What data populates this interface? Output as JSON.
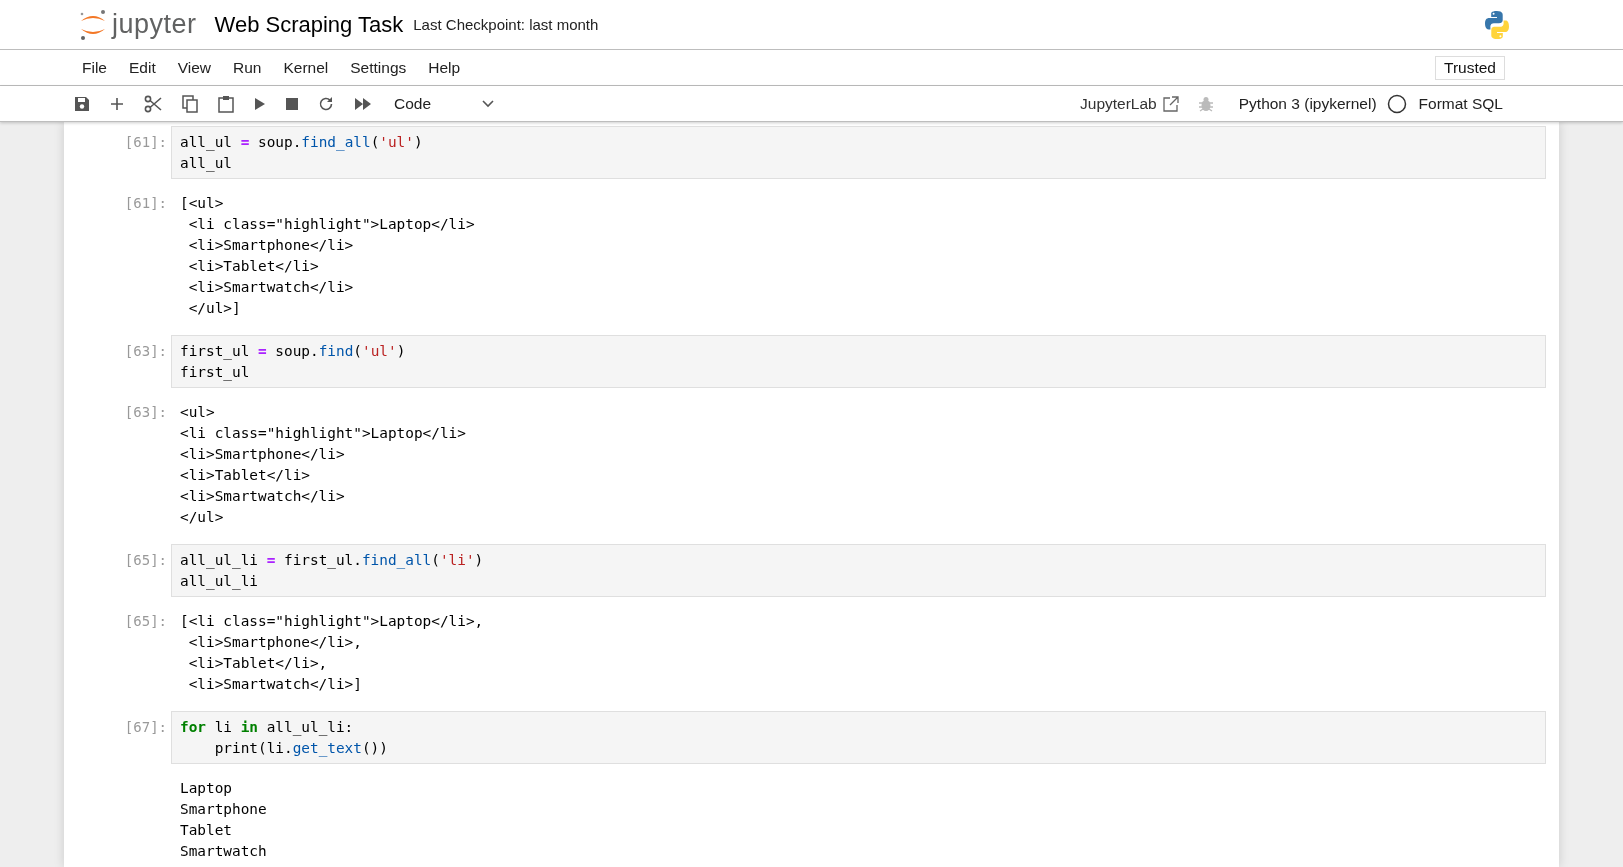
{
  "header": {
    "logo_text": "jupyter",
    "title": "Web Scraping Task",
    "checkpoint": "Last Checkpoint: last month"
  },
  "menu": [
    "File",
    "Edit",
    "View",
    "Run",
    "Kernel",
    "Settings",
    "Help"
  ],
  "trusted": "Trusted",
  "toolbar": {
    "cell_type": "Code",
    "jupyterlab": "JupyterLab",
    "kernel": "Python 3 (ipykernel)",
    "kernel_busy": false,
    "format": "Format SQL"
  },
  "cells": [
    {
      "kind": "code",
      "prompt": "[61]:",
      "lines": [
        [
          {
            "kind": "plain",
            "text": "all_ul "
          },
          {
            "kind": "op",
            "text": "="
          },
          {
            "kind": "plain",
            "text": " soup."
          },
          {
            "kind": "func",
            "text": "find_all"
          },
          {
            "kind": "plain",
            "text": "("
          },
          {
            "kind": "string",
            "text": "'ul'"
          },
          {
            "kind": "plain",
            "text": ")"
          }
        ],
        [
          {
            "kind": "plain",
            "text": "all_ul"
          }
        ]
      ]
    },
    {
      "kind": "output",
      "prompt": "[61]:",
      "lines": [
        "[<ul>",
        " <li class=\"highlight\">Laptop</li>",
        " <li>Smartphone</li>",
        " <li>Tablet</li>",
        " <li>Smartwatch</li>",
        " </ul>]"
      ]
    },
    {
      "kind": "code",
      "prompt": "[63]:",
      "lines": [
        [
          {
            "kind": "plain",
            "text": "first_ul "
          },
          {
            "kind": "op",
            "text": "="
          },
          {
            "kind": "plain",
            "text": " soup."
          },
          {
            "kind": "func",
            "text": "find"
          },
          {
            "kind": "plain",
            "text": "("
          },
          {
            "kind": "string",
            "text": "'ul'"
          },
          {
            "kind": "plain",
            "text": ")"
          }
        ],
        [
          {
            "kind": "plain",
            "text": "first_ul"
          }
        ]
      ]
    },
    {
      "kind": "output",
      "prompt": "[63]:",
      "lines": [
        "<ul>",
        "<li class=\"highlight\">Laptop</li>",
        "<li>Smartphone</li>",
        "<li>Tablet</li>",
        "<li>Smartwatch</li>",
        "</ul>"
      ]
    },
    {
      "kind": "code",
      "prompt": "[65]:",
      "lines": [
        [
          {
            "kind": "plain",
            "text": "all_ul_li "
          },
          {
            "kind": "op",
            "text": "="
          },
          {
            "kind": "plain",
            "text": " first_ul."
          },
          {
            "kind": "func",
            "text": "find_all"
          },
          {
            "kind": "plain",
            "text": "("
          },
          {
            "kind": "string",
            "text": "'li'"
          },
          {
            "kind": "plain",
            "text": ")"
          }
        ],
        [
          {
            "kind": "plain",
            "text": "all_ul_li"
          }
        ]
      ]
    },
    {
      "kind": "output",
      "prompt": "[65]:",
      "lines": [
        "[<li class=\"highlight\">Laptop</li>,",
        " <li>Smartphone</li>,",
        " <li>Tablet</li>,",
        " <li>Smartwatch</li>]"
      ]
    },
    {
      "kind": "code",
      "prompt": "[67]:",
      "lines": [
        [
          {
            "kind": "keyword",
            "text": "for"
          },
          {
            "kind": "plain",
            "text": " li "
          },
          {
            "kind": "keyword",
            "text": "in"
          },
          {
            "kind": "plain",
            "text": " all_ul_li:"
          }
        ],
        [
          {
            "kind": "plain",
            "text": "    print(li."
          },
          {
            "kind": "func",
            "text": "get_text"
          },
          {
            "kind": "plain",
            "text": "())"
          }
        ]
      ]
    },
    {
      "kind": "output",
      "lines": [
        "Laptop",
        "Smartphone",
        "Tablet",
        "Smartwatch"
      ]
    }
  ]
}
